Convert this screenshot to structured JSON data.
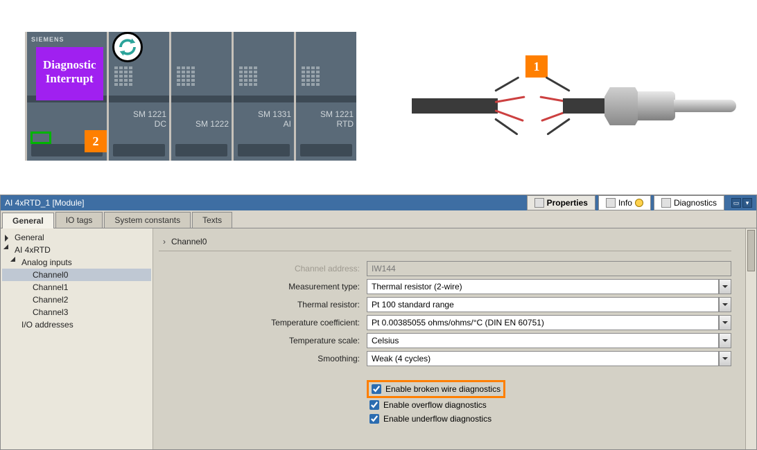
{
  "illustration": {
    "brand": "SIEMENS",
    "diag_label": "Diagnostic\nInterrupt",
    "badge1": "1",
    "badge2": "2",
    "modules": [
      {
        "line1": "SM 1221",
        "line2": "DC"
      },
      {
        "line1": "SM 1222",
        "line2": ""
      },
      {
        "line1": "SM 1331",
        "line2": "AI"
      },
      {
        "line1": "SM 1221",
        "line2": "RTD"
      }
    ]
  },
  "window": {
    "title": "AI 4xRTD_1 [Module]",
    "top_tabs": {
      "properties": "Properties",
      "info": "Info",
      "diagnostics": "Diagnostics"
    },
    "sub_tabs": {
      "general": "General",
      "io_tags": "IO tags",
      "system_constants": "System constants",
      "texts": "Texts"
    }
  },
  "tree": {
    "general": "General",
    "module": "AI 4xRTD",
    "analog_inputs": "Analog inputs",
    "channels": [
      "Channel0",
      "Channel1",
      "Channel2",
      "Channel3"
    ],
    "io_addresses": "I/O addresses"
  },
  "section_title": "Channel0",
  "fields": {
    "address_label": "Channel address:",
    "address_value": "IW144",
    "meas_label": "Measurement type:",
    "meas_value": "Thermal resistor (2-wire)",
    "resistor_label": "Thermal resistor:",
    "resistor_value": "Pt 100 standard range",
    "coef_label": "Temperature coefficient:",
    "coef_value": "Pt 0.00385055 ohms/ohms/°C (DIN EN 60751)",
    "scale_label": "Temperature scale:",
    "scale_value": "Celsius",
    "smooth_label": "Smoothing:",
    "smooth_value": "Weak (4 cycles)"
  },
  "checks": {
    "broken": "Enable broken wire diagnostics",
    "overflow": "Enable overflow diagnostics",
    "underflow": "Enable underflow diagnostics"
  }
}
